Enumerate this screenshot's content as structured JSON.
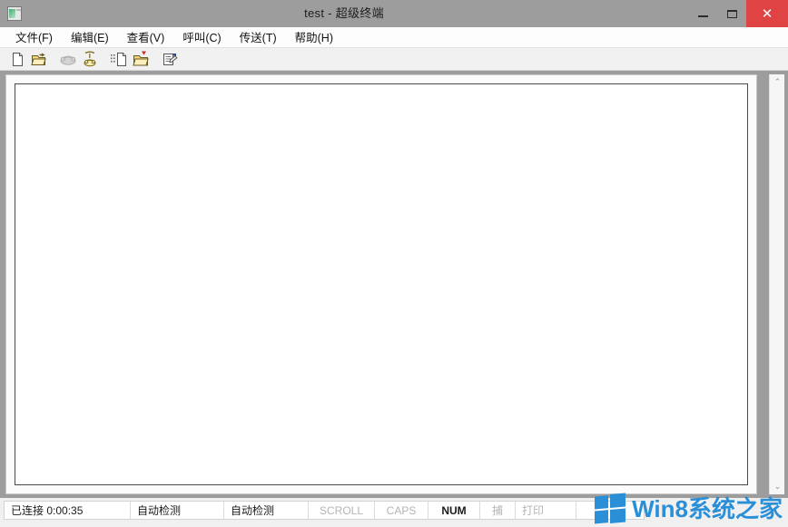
{
  "window": {
    "title": "test - 超级终端",
    "icon": "terminal-window-icon",
    "titlebar_color": "#9d9d9d",
    "controls": {
      "minimize": "—",
      "maximize": "▢",
      "close": "✕",
      "close_color": "#e04343"
    }
  },
  "menubar": {
    "items": [
      {
        "label": "文件(F)",
        "name": "menu-file"
      },
      {
        "label": "编辑(E)",
        "name": "menu-edit"
      },
      {
        "label": "查看(V)",
        "name": "menu-view"
      },
      {
        "label": "呼叫(C)",
        "name": "menu-call"
      },
      {
        "label": "传送(T)",
        "name": "menu-transfer"
      },
      {
        "label": "帮助(H)",
        "name": "menu-help"
      }
    ]
  },
  "toolbar": {
    "buttons": [
      {
        "icon": "new-document-icon",
        "enabled": true
      },
      {
        "icon": "open-folder-icon",
        "enabled": true
      },
      {
        "icon": "disconnect-phone-icon",
        "enabled": false
      },
      {
        "icon": "call-phone-icon",
        "enabled": true
      },
      {
        "icon": "send-file-icon",
        "enabled": true
      },
      {
        "icon": "receive-file-icon",
        "enabled": true
      },
      {
        "icon": "properties-icon",
        "enabled": true
      }
    ]
  },
  "terminal": {
    "content": "",
    "background": "#ffffff"
  },
  "scrollbar": {
    "up_arrow": "⌃",
    "down_arrow": "⌄"
  },
  "statusbar": {
    "cells": [
      {
        "label": "已连接 0:00:35",
        "state": "active",
        "name": "status-connected-time"
      },
      {
        "label": "自动检测",
        "state": "active",
        "name": "status-autodetect-protocol"
      },
      {
        "label": "自动检测",
        "state": "active",
        "name": "status-autodetect-speed"
      },
      {
        "label": "SCROLL",
        "state": "dim",
        "name": "status-scroll"
      },
      {
        "label": "CAPS",
        "state": "dim",
        "name": "status-caps"
      },
      {
        "label": "NUM",
        "state": "strong",
        "name": "status-num"
      },
      {
        "label": "捕",
        "state": "dim",
        "name": "status-capture"
      },
      {
        "label": "打印",
        "state": "dim",
        "name": "status-print"
      }
    ]
  },
  "watermark": {
    "text": "Win8系统之家",
    "color": "#2b8fd8",
    "logo": "windows-logo-icon"
  }
}
